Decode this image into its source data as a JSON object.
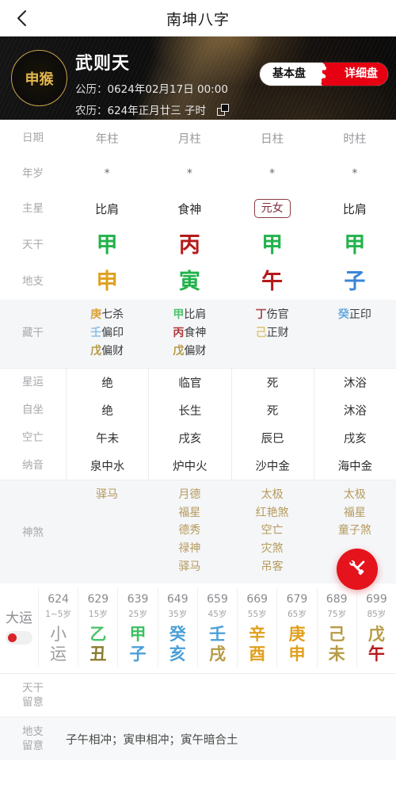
{
  "nav": {
    "back_icon": "chevron-left-icon",
    "title": "南坤八字"
  },
  "hero": {
    "zodiac": "申猴",
    "name": "武则天",
    "solar_label": "公历：",
    "solar_value": "0624年02月17日 00:00",
    "lunar_label": "农历：",
    "lunar_value": "624年正月廿三 子时",
    "copy_icon": "copy-icon",
    "toggle": {
      "left": "基本盘",
      "right": "详细盘",
      "active": "详细盘"
    }
  },
  "colors": {
    "wood": "#22b24c",
    "fire": "#b51a1a",
    "earth": "#8a7b2e",
    "metal": "#e0a01f",
    "water": "#3b86d8",
    "accent_red": "#e4131c",
    "gold": "#c9a24a",
    "shensha": "#b59a5c"
  },
  "table": {
    "row_date_label": "日期",
    "pillars": [
      "年柱",
      "月柱",
      "日柱",
      "时柱"
    ],
    "row_age_label": "年岁",
    "ages": [
      "*",
      "*",
      "*",
      "*"
    ],
    "row_main_star_label": "主星",
    "main_stars": [
      "比肩",
      "食神",
      "元女",
      "比肩"
    ],
    "main_star_boxed_index": 2,
    "row_gan_label": "天干",
    "gans": [
      {
        "ch": "甲",
        "color": "#22b24c"
      },
      {
        "ch": "丙",
        "color": "#b51a1a"
      },
      {
        "ch": "甲",
        "color": "#22b24c"
      },
      {
        "ch": "甲",
        "color": "#22b24c"
      }
    ],
    "row_zhi_label": "地支",
    "zhis": [
      {
        "ch": "申",
        "color": "#e0a01f"
      },
      {
        "ch": "寅",
        "color": "#22b24c"
      },
      {
        "ch": "午",
        "color": "#b51a1a"
      },
      {
        "ch": "子",
        "color": "#3b86d8"
      }
    ],
    "row_cang_label": "藏干",
    "cang": [
      [
        {
          "g": "庚",
          "gc": "#d9a63c",
          "s": "七杀"
        },
        {
          "g": "壬",
          "gc": "#8fc0e8",
          "s": "偏印"
        },
        {
          "g": "戊",
          "gc": "#b79b45",
          "s": "偏财"
        }
      ],
      [
        {
          "g": "甲",
          "gc": "#4cc46b",
          "s": "比肩"
        },
        {
          "g": "丙",
          "gc": "#b23b3b",
          "s": "食神"
        },
        {
          "g": "戊",
          "gc": "#b79b45",
          "s": "偏财"
        }
      ],
      [
        {
          "g": "丁",
          "gc": "#a8494c",
          "s": "伤官"
        },
        {
          "g": "己",
          "gc": "#ddc878",
          "s": "正财"
        }
      ],
      [
        {
          "g": "癸",
          "gc": "#6aa9e0",
          "s": "正印"
        }
      ]
    ],
    "stat_rows": [
      {
        "label": "星运",
        "values": [
          "绝",
          "临官",
          "死",
          "沐浴"
        ]
      },
      {
        "label": "自坐",
        "values": [
          "绝",
          "长生",
          "死",
          "沐浴"
        ]
      },
      {
        "label": "空亡",
        "values": [
          "午未",
          "戌亥",
          "辰巳",
          "戌亥"
        ]
      },
      {
        "label": "纳音",
        "values": [
          "泉中水",
          "炉中火",
          "沙中金",
          "海中金"
        ]
      }
    ],
    "row_shensha_label": "神煞",
    "shensha": [
      [
        "驿马"
      ],
      [
        "月德",
        "福星",
        "德秀",
        "禄神",
        "驿马"
      ],
      [
        "太极",
        "红艳煞",
        "空亡",
        "灾煞",
        "吊客"
      ],
      [
        "太极",
        "福星",
        "童子煞"
      ]
    ]
  },
  "fab": {
    "icon": "tools-icon"
  },
  "dayun": {
    "label": "大运",
    "toggle_state": "on",
    "columns": [
      {
        "year": "624",
        "age": "1~5岁",
        "gan": "小",
        "zhi": "运",
        "gan_color": "#9d9da2",
        "zhi_color": "#9d9da2",
        "is_small": true
      },
      {
        "year": "629",
        "age": "15岁",
        "gan": "乙",
        "zhi": "丑",
        "gan_color": "#4cc46b",
        "zhi_color": "#8a7b2e",
        "is_small": false
      },
      {
        "year": "639",
        "age": "25岁",
        "gan": "甲",
        "zhi": "子",
        "gan_color": "#3fbf63",
        "zhi_color": "#4a9fd8",
        "is_small": false
      },
      {
        "year": "649",
        "age": "35岁",
        "gan": "癸",
        "zhi": "亥",
        "gan_color": "#4a9fd8",
        "zhi_color": "#4a9fd8",
        "is_small": false
      },
      {
        "year": "659",
        "age": "45岁",
        "gan": "壬",
        "zhi": "戌",
        "gan_color": "#4a9fd8",
        "zhi_color": "#b79b45",
        "is_small": false
      },
      {
        "year": "669",
        "age": "55岁",
        "gan": "辛",
        "zhi": "酉",
        "gan_color": "#e0a01f",
        "zhi_color": "#e0a01f",
        "is_small": false
      },
      {
        "year": "679",
        "age": "65岁",
        "gan": "庚",
        "zhi": "申",
        "gan_color": "#e0a01f",
        "zhi_color": "#e0a01f",
        "is_small": false
      },
      {
        "year": "689",
        "age": "75岁",
        "gan": "己",
        "zhi": "未",
        "gan_color": "#b79b45",
        "zhi_color": "#b79b45",
        "is_small": false
      },
      {
        "year": "699",
        "age": "85岁",
        "gan": "戊",
        "zhi": "午",
        "gan_color": "#b79b45",
        "zhi_color": "#b51a1a",
        "is_small": false
      }
    ]
  },
  "notes": [
    {
      "label": "天干\n留意",
      "text": ""
    },
    {
      "label": "地支\n留意",
      "text": "子午相冲；寅申相冲；寅午暗合土"
    }
  ]
}
